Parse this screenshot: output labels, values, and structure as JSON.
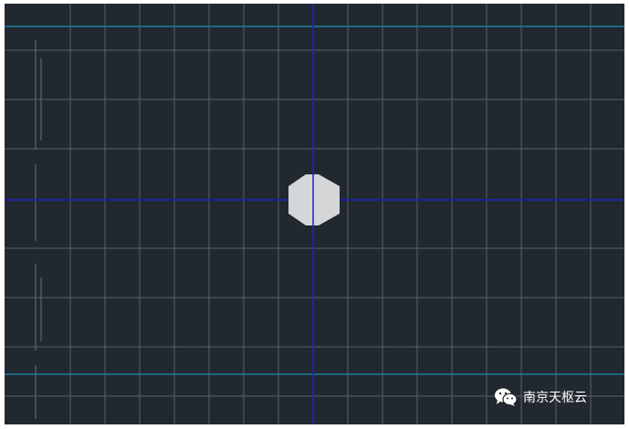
{
  "app": {
    "view": "cad-drawing-viewport",
    "background_color": "#212830"
  },
  "viewport": {
    "grid_color": "#5a6068",
    "guide_line_color": "#1a7f9e",
    "crosshair_color": "#1d22c8",
    "marker_fill": "#d4d6d8",
    "marker_shape": "octagon"
  },
  "watermark": {
    "icon": "wechat-icon",
    "text": "南京天枢云"
  }
}
